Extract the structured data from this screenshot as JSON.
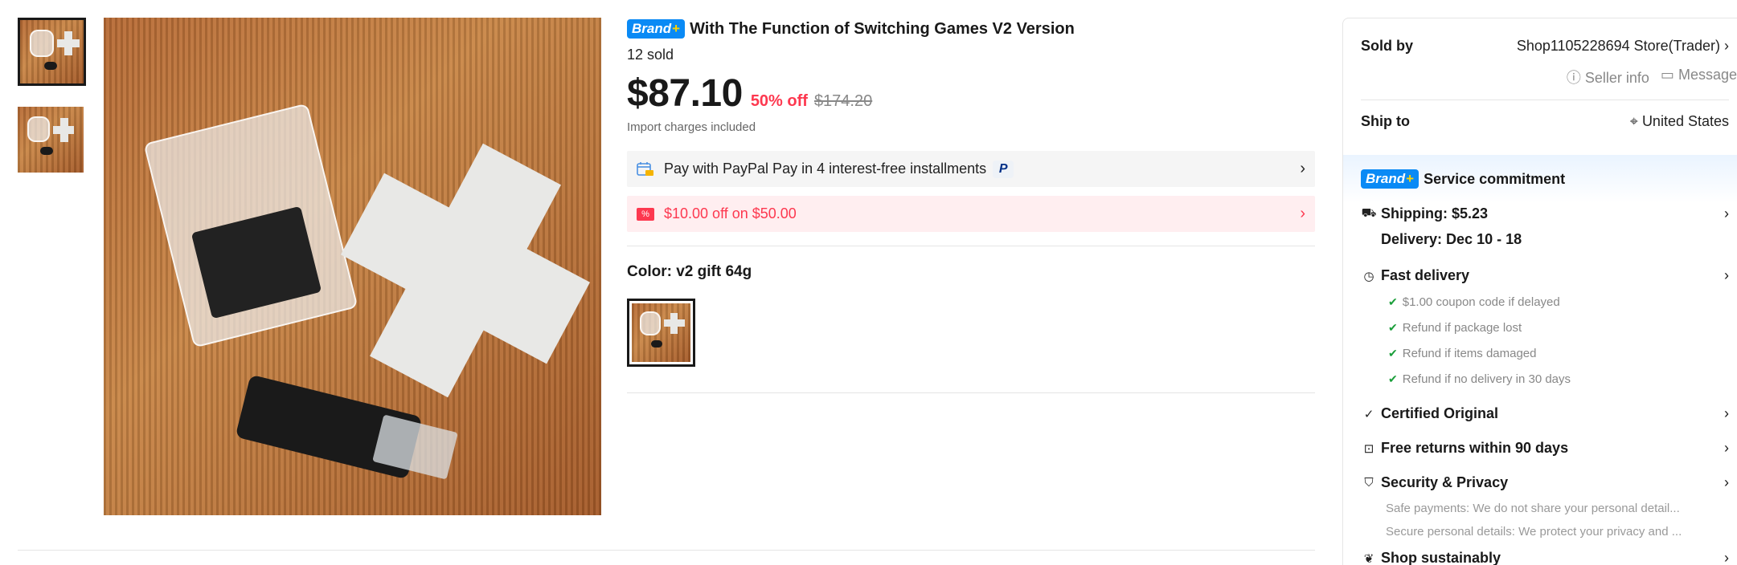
{
  "product": {
    "brand_badge": "Brand",
    "brand_plus": "+",
    "title": "With The Function of Switching Games V2 Version",
    "sold": "12 sold",
    "price": "$87.10",
    "discount": "50% off",
    "original_price": "$174.20",
    "import_note": "Import charges included"
  },
  "banners": {
    "paypal_text": "Pay with PayPal Pay in 4 interest-free installments",
    "paypal_logo": "P",
    "coupon_icon": "%",
    "coupon_text": "$10.00 off on $50.00",
    "chevron": "›"
  },
  "color": {
    "label": "Color: v2 gift 64g"
  },
  "seller": {
    "sold_by_label": "Sold by",
    "store_name": "Shop1105228694 Store(Trader)",
    "seller_info": "Seller info",
    "message": "Message",
    "ship_to_label": "Ship to",
    "ship_to_value": "United States"
  },
  "service": {
    "badge": "Brand",
    "badge_plus": "+",
    "title": "Service commitment",
    "shipping": "Shipping: $5.23",
    "delivery": "Delivery: Dec 10 - 18",
    "fast_delivery": "Fast delivery",
    "bullets": [
      "$1.00 coupon code if delayed",
      "Refund if package lost",
      "Refund if items damaged",
      "Refund if no delivery in 30 days"
    ],
    "certified": "Certified Original",
    "returns": "Free returns within 90 days",
    "security": "Security & Privacy",
    "security_lines": [
      "Safe payments: We do not share your personal detail...",
      "Secure personal details: We protect your privacy and ..."
    ],
    "sustainably": "Shop sustainably"
  },
  "colors": {
    "accent_red": "#fd384f",
    "brand_blue": "#0a8af5"
  }
}
